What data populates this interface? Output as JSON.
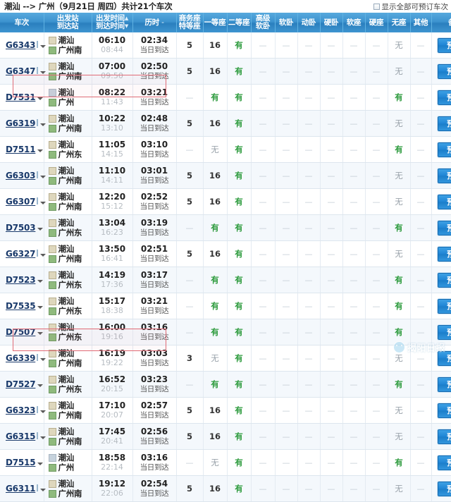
{
  "header": {
    "route_summary": "潮汕 --> 广州（9月21日  周四）共计21个车次",
    "origin": "潮汕",
    "destination": "广州",
    "arrow": "-->",
    "date": "9月21日",
    "weekday": "周四",
    "count_text": "共计21个车次",
    "show_all_label": "显示全部可预订车次"
  },
  "columns": {
    "train_no": "车次",
    "station_top": "出发站",
    "station_bottom": "到达站",
    "time_top": "出发时间",
    "time_bottom": "到达时间",
    "duration": "历时",
    "business_top": "商务座",
    "business_bottom": "特等座",
    "first_class": "一等座",
    "second_class": "二等座",
    "senior_soft_top": "高级",
    "senior_soft_bottom": "软卧",
    "soft_sleeper": "软卧",
    "emu_sleeper": "动卧",
    "hard_sleeper": "硬卧",
    "soft_seat": "软座",
    "hard_seat": "硬座",
    "no_seat": "无座",
    "other": "其他",
    "remark": "备注"
  },
  "book_label": "预订",
  "arrival_note": "当日到达",
  "watermark": "揭阳日报",
  "rows": [
    {
      "train": "G6343",
      "type": "G",
      "from": "潮汕",
      "to": "广州南",
      "dep": "06:10",
      "arr": "08:44",
      "dur": "02:34",
      "note": "当日到达",
      "business": "5",
      "first": "16",
      "second": "有",
      "senior": "—",
      "soft": "—",
      "emu": "—",
      "hard_sl": "—",
      "soft_st": "—",
      "hard_st": "—",
      "no_seat": "无",
      "other": "—",
      "highlight": false
    },
    {
      "train": "G6347",
      "type": "G",
      "from": "潮汕",
      "to": "广州南",
      "dep": "07:00",
      "arr": "09:50",
      "dur": "02:50",
      "note": "当日到达",
      "business": "5",
      "first": "16",
      "second": "有",
      "senior": "—",
      "soft": "—",
      "emu": "—",
      "hard_sl": "—",
      "soft_st": "—",
      "hard_st": "—",
      "no_seat": "无",
      "other": "—",
      "highlight": false
    },
    {
      "train": "D7531",
      "type": "D",
      "from": "潮汕",
      "to": "广州",
      "dep": "08:22",
      "arr": "11:43",
      "dur": "03:21",
      "note": "当日到达",
      "business": "—",
      "first": "有",
      "second": "有",
      "senior": "—",
      "soft": "—",
      "emu": "—",
      "hard_sl": "—",
      "soft_st": "—",
      "hard_st": "—",
      "no_seat": "有",
      "other": "—",
      "highlight": true
    },
    {
      "train": "G6319",
      "type": "G",
      "from": "潮汕",
      "to": "广州南",
      "dep": "10:22",
      "arr": "13:10",
      "dur": "02:48",
      "note": "当日到达",
      "business": "5",
      "first": "16",
      "second": "有",
      "senior": "—",
      "soft": "—",
      "emu": "—",
      "hard_sl": "—",
      "soft_st": "—",
      "hard_st": "—",
      "no_seat": "无",
      "other": "—",
      "highlight": false
    },
    {
      "train": "D7511",
      "type": "D",
      "from": "潮汕",
      "to": "广州东",
      "dep": "11:05",
      "arr": "14:15",
      "dur": "03:10",
      "note": "当日到达",
      "business": "—",
      "first": "无",
      "second": "有",
      "senior": "—",
      "soft": "—",
      "emu": "—",
      "hard_sl": "—",
      "soft_st": "—",
      "hard_st": "—",
      "no_seat": "有",
      "other": "—",
      "highlight": false
    },
    {
      "train": "G6303",
      "type": "G",
      "from": "潮汕",
      "to": "广州南",
      "dep": "11:10",
      "arr": "14:11",
      "dur": "03:01",
      "note": "当日到达",
      "business": "5",
      "first": "16",
      "second": "有",
      "senior": "—",
      "soft": "—",
      "emu": "—",
      "hard_sl": "—",
      "soft_st": "—",
      "hard_st": "—",
      "no_seat": "无",
      "other": "—",
      "highlight": false
    },
    {
      "train": "G6307",
      "type": "G",
      "from": "潮汕",
      "to": "广州南",
      "dep": "12:20",
      "arr": "15:12",
      "dur": "02:52",
      "note": "当日到达",
      "business": "5",
      "first": "16",
      "second": "有",
      "senior": "—",
      "soft": "—",
      "emu": "—",
      "hard_sl": "—",
      "soft_st": "—",
      "hard_st": "—",
      "no_seat": "无",
      "other": "—",
      "highlight": false
    },
    {
      "train": "D7503",
      "type": "D",
      "from": "潮汕",
      "to": "广州东",
      "dep": "13:04",
      "arr": "16:23",
      "dur": "03:19",
      "note": "当日到达",
      "business": "—",
      "first": "有",
      "second": "有",
      "senior": "—",
      "soft": "—",
      "emu": "—",
      "hard_sl": "—",
      "soft_st": "—",
      "hard_st": "—",
      "no_seat": "有",
      "other": "—",
      "highlight": false
    },
    {
      "train": "G6327",
      "type": "G",
      "from": "潮汕",
      "to": "广州南",
      "dep": "13:50",
      "arr": "16:41",
      "dur": "02:51",
      "note": "当日到达",
      "business": "5",
      "first": "16",
      "second": "有",
      "senior": "—",
      "soft": "—",
      "emu": "—",
      "hard_sl": "—",
      "soft_st": "—",
      "hard_st": "—",
      "no_seat": "无",
      "other": "—",
      "highlight": false
    },
    {
      "train": "D7523",
      "type": "D",
      "from": "潮汕",
      "to": "广州东",
      "dep": "14:19",
      "arr": "17:36",
      "dur": "03:17",
      "note": "当日到达",
      "business": "—",
      "first": "有",
      "second": "有",
      "senior": "—",
      "soft": "—",
      "emu": "—",
      "hard_sl": "—",
      "soft_st": "—",
      "hard_st": "—",
      "no_seat": "有",
      "other": "—",
      "highlight": false
    },
    {
      "train": "D7535",
      "type": "D",
      "from": "潮汕",
      "to": "广州东",
      "dep": "15:17",
      "arr": "18:38",
      "dur": "03:21",
      "note": "当日到达",
      "business": "—",
      "first": "有",
      "second": "有",
      "senior": "—",
      "soft": "—",
      "emu": "—",
      "hard_sl": "—",
      "soft_st": "—",
      "hard_st": "—",
      "no_seat": "有",
      "other": "—",
      "highlight": false
    },
    {
      "train": "D7507",
      "type": "D",
      "from": "潮汕",
      "to": "广州东",
      "dep": "16:00",
      "arr": "19:16",
      "dur": "03:16",
      "note": "当日到达",
      "business": "—",
      "first": "有",
      "second": "有",
      "senior": "—",
      "soft": "—",
      "emu": "—",
      "hard_sl": "—",
      "soft_st": "—",
      "hard_st": "—",
      "no_seat": "有",
      "other": "—",
      "highlight": false
    },
    {
      "train": "G6339",
      "type": "G",
      "from": "潮汕",
      "to": "广州南",
      "dep": "16:19",
      "arr": "19:22",
      "dur": "03:03",
      "note": "当日到达",
      "business": "3",
      "first": "无",
      "second": "有",
      "senior": "—",
      "soft": "—",
      "emu": "—",
      "hard_sl": "—",
      "soft_st": "—",
      "hard_st": "—",
      "no_seat": "无",
      "other": "—",
      "highlight": false
    },
    {
      "train": "D7527",
      "type": "D",
      "from": "潮汕",
      "to": "广州东",
      "dep": "16:52",
      "arr": "20:15",
      "dur": "03:23",
      "note": "当日到达",
      "business": "—",
      "first": "有",
      "second": "有",
      "senior": "—",
      "soft": "—",
      "emu": "—",
      "hard_sl": "—",
      "soft_st": "—",
      "hard_st": "—",
      "no_seat": "有",
      "other": "—",
      "highlight": false
    },
    {
      "train": "G6323",
      "type": "G",
      "from": "潮汕",
      "to": "广州南",
      "dep": "17:10",
      "arr": "20:07",
      "dur": "02:57",
      "note": "当日到达",
      "business": "5",
      "first": "16",
      "second": "有",
      "senior": "—",
      "soft": "—",
      "emu": "—",
      "hard_sl": "—",
      "soft_st": "—",
      "hard_st": "—",
      "no_seat": "无",
      "other": "—",
      "highlight": false
    },
    {
      "train": "G6315",
      "type": "G",
      "from": "潮汕",
      "to": "广州南",
      "dep": "17:45",
      "arr": "20:41",
      "dur": "02:56",
      "note": "当日到达",
      "business": "5",
      "first": "16",
      "second": "有",
      "senior": "—",
      "soft": "—",
      "emu": "—",
      "hard_sl": "—",
      "soft_st": "—",
      "hard_st": "—",
      "no_seat": "无",
      "other": "—",
      "highlight": false
    },
    {
      "train": "D7515",
      "type": "D",
      "from": "潮汕",
      "to": "广州",
      "dep": "18:58",
      "arr": "22:14",
      "dur": "03:16",
      "note": "当日到达",
      "business": "—",
      "first": "无",
      "second": "有",
      "senior": "—",
      "soft": "—",
      "emu": "—",
      "hard_sl": "—",
      "soft_st": "—",
      "hard_st": "—",
      "no_seat": "有",
      "other": "—",
      "highlight": true
    },
    {
      "train": "G6311",
      "type": "G",
      "from": "潮汕",
      "to": "广州南",
      "dep": "19:12",
      "arr": "22:06",
      "dur": "02:54",
      "note": "当日到达",
      "business": "5",
      "first": "16",
      "second": "有",
      "senior": "—",
      "soft": "—",
      "emu": "—",
      "hard_sl": "—",
      "soft_st": "—",
      "hard_st": "—",
      "no_seat": "无",
      "other": "—",
      "highlight": false
    }
  ],
  "colors": {
    "header_blue": "#3d93cf",
    "button_blue": "#1e84d4",
    "available_green": "#2e9b3e",
    "unavailable_gray": "#9aa3ab",
    "annotation_red": "#e06b76"
  }
}
